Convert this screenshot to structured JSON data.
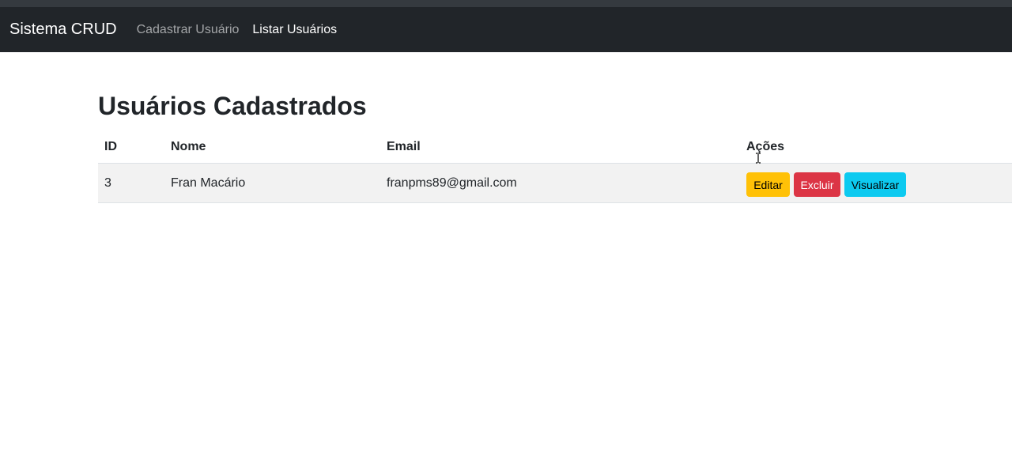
{
  "navbar": {
    "brand": "Sistema CRUD",
    "links": [
      {
        "label": "Cadastrar Usuário",
        "active": false
      },
      {
        "label": "Listar Usuários",
        "active": true
      }
    ]
  },
  "page": {
    "title": "Usuários Cadastrados"
  },
  "table": {
    "headers": [
      "ID",
      "Nome",
      "Email",
      "Ações"
    ],
    "rows": [
      {
        "id": "3",
        "nome": "Fran Macário",
        "email": "franpms89@gmail.com",
        "actions": [
          "Editar",
          "Excluir",
          "Visualizar"
        ]
      }
    ]
  },
  "colors": {
    "navbar_bg": "#212529",
    "edit_button": "#ffc107",
    "delete_button": "#dc3545",
    "view_button": "#0dcaf0",
    "striped_row": "#f2f2f2"
  },
  "icons": {
    "mouse_cursor": "text-cursor-icon"
  }
}
